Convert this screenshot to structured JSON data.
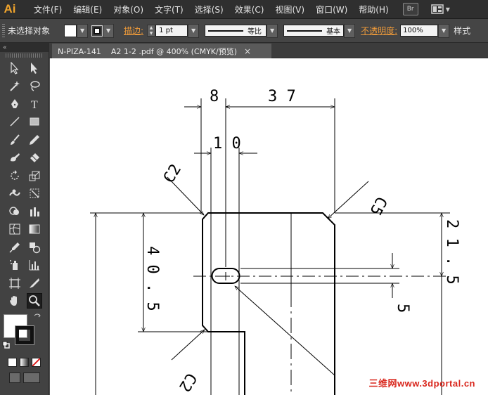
{
  "app": {
    "logo": "Ai"
  },
  "menu": {
    "items": [
      "文件(F)",
      "编辑(E)",
      "对象(O)",
      "文字(T)",
      "选择(S)",
      "效果(C)",
      "视图(V)",
      "窗口(W)",
      "帮助(H)"
    ],
    "bridge_label": "Br"
  },
  "control": {
    "selection_status": "未选择对象",
    "stroke_label": "描边:",
    "stroke_weight": "1 pt",
    "profile_equal": "等比",
    "brush_basic": "基本",
    "opacity_label": "不透明度:",
    "opacity_value": "100%",
    "style_label": "样式"
  },
  "tools_panel": {
    "collapse_icon": "«"
  },
  "document": {
    "tab_title": "N-PIZA-141    A2 1-2 .pdf @ 400% (CMYK/预览)",
    "close_glyph": "×"
  },
  "drawing": {
    "dimensions": {
      "d8": "8",
      "d37": "3 7",
      "d10": "1 0",
      "c2_top": "C2",
      "c5": "C5",
      "d40_5": "4 0 . 5",
      "d21_5": "2 1 . 5",
      "d5": "5",
      "c2_bottom": "C2"
    }
  },
  "watermark": {
    "text": "三维网www.3dportal.cn"
  },
  "colors": {
    "accent_orange": "#ef9b3a",
    "logo_orange": "#f0a42c",
    "watermark_red": "#d9261c",
    "ui_dark": "#424242"
  }
}
